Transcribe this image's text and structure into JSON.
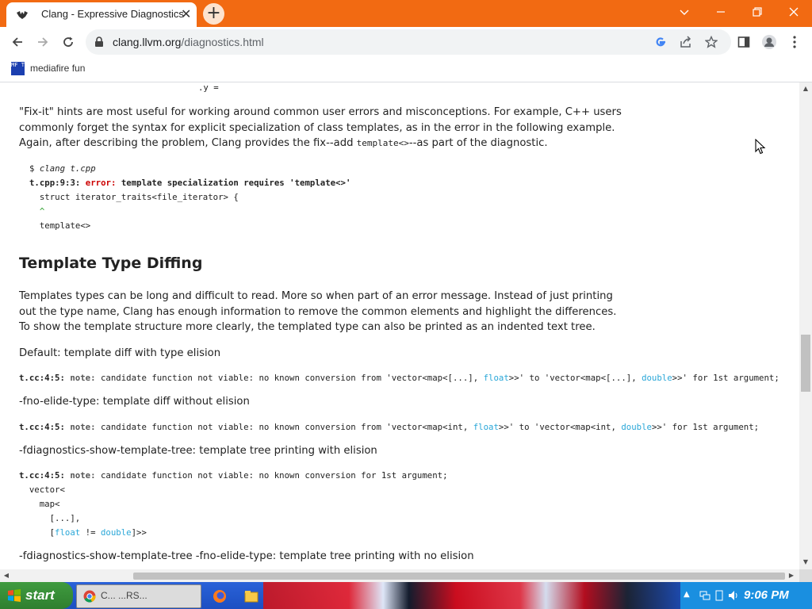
{
  "browser": {
    "tab_title": "Clang - Expressive Diagnostics",
    "tab_close": "✕",
    "new_tab": "+",
    "url_domain": "clang.llvm.org",
    "url_path": "/diagnostics.html",
    "bookmark_label": "mediafire fun",
    "bookmark_icon_text": "MF T"
  },
  "page": {
    "top_fragment": ".y =",
    "fixit_paragraph_1": "\"Fix-it\" hints are most useful for working around common user errors and misconceptions. For example, C++ users commonly forget the syntax for explicit specialization of class templates, as in the error in the following example. Again, after describing the problem, Clang provides the fix--add ",
    "fixit_code": "template<>",
    "fixit_paragraph_2": "--as part of the diagnostic.",
    "code1": {
      "prompt": "$ ",
      "command": "clang t.cpp",
      "loc": "t.cpp:9:3: ",
      "error": "error:",
      "message": " template specialization requires 'template<>'",
      "line3": "  struct iterator_traits<file_iterator> {",
      "line4": "  ^",
      "line5": "  template<>"
    },
    "heading": "Template Type Diffing",
    "diff_paragraph": "Templates types can be long and difficult to read. More so when part of an error message. Instead of just printing out the type name, Clang has enough information to remove the common elements and highlight the differences. To show the template structure more clearly, the templated type can also be printed as an indented text tree.",
    "default_label": "Default: template diff with type elision",
    "diag1": {
      "loc": "t.cc:4:5: ",
      "note": "note:",
      "a": " candidate function not viable: no known conversion from 'vector<map<[...], ",
      "t1": "float",
      "b": ">>' to 'vector<map<[...], ",
      "t2": "double",
      "c": ">>' for 1st argument;"
    },
    "no_elide_label": "-fno-elide-type: template diff without elision",
    "diag2": {
      "loc": "t.cc:4:5: ",
      "note": "note:",
      "a": " candidate function not viable: no known conversion from 'vector<map<int, ",
      "t1": "float",
      "b": ">>' to 'vector<map<int, ",
      "t2": "double",
      "c": ">>' for 1st argument;"
    },
    "tree_label": "-fdiagnostics-show-template-tree: template tree printing with elision",
    "diag3": {
      "loc": "t.cc:4:5: ",
      "note": "note:",
      "a": " candidate function not viable: no known conversion for 1st argument;",
      "l2": "  vector<",
      "l3": "    map<",
      "l4": "      [...],",
      "l5a": "      [",
      "t1": "float",
      "l5b": " != ",
      "t2": "double",
      "l5c": "]>>"
    },
    "tree_no_elide_label": "-fdiagnostics-show-template-tree -fno-elide-type: template tree printing with no elision"
  },
  "taskbar": {
    "start_label": "start",
    "task_label": "C...  ...RS...",
    "clock": "9:06 PM"
  },
  "colors": {
    "title_bar": "#f26a12",
    "error": "#cc0000",
    "type_highlight": "#2aa7d8"
  }
}
